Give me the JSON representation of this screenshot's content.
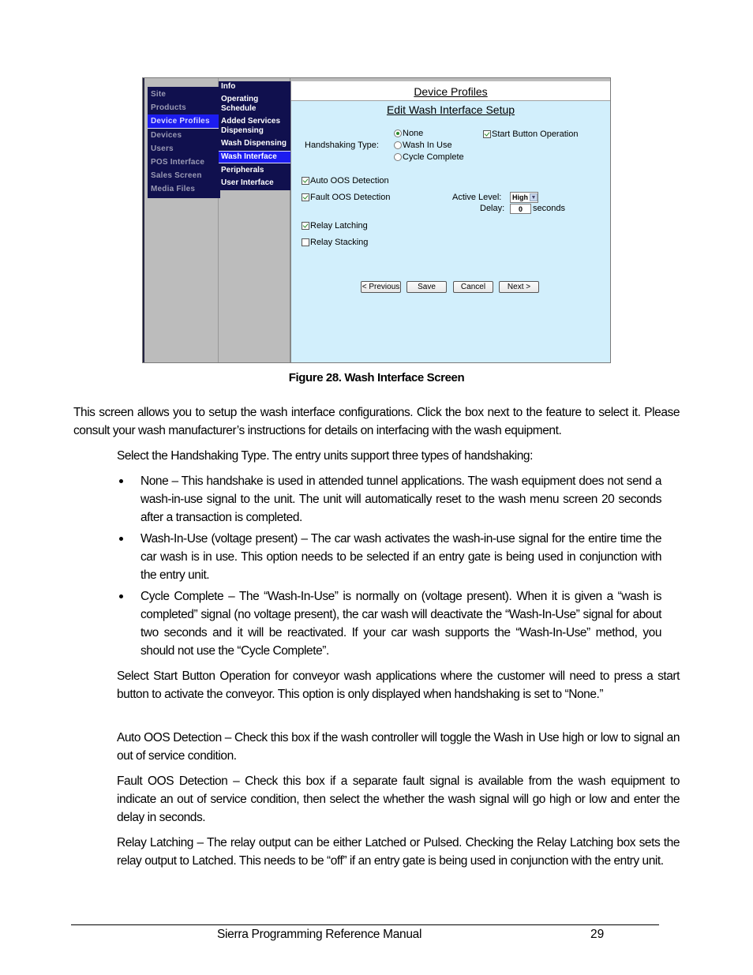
{
  "screenshot": {
    "left_menu": [
      {
        "label": "Site",
        "active": false
      },
      {
        "label": "Products",
        "active": false
      },
      {
        "label": "Device Profiles",
        "active": true
      },
      {
        "label": "Devices",
        "active": false
      },
      {
        "label": "Users",
        "active": false
      },
      {
        "label": "POS Interface",
        "active": false
      },
      {
        "label": "Sales Screen",
        "active": false
      },
      {
        "label": "Media Files",
        "active": false
      }
    ],
    "sub_menu": [
      {
        "label": "Info",
        "active": false
      },
      {
        "label": "Operating Schedule",
        "active": false
      },
      {
        "label": "Added Services Dispensing",
        "active": false
      },
      {
        "label": "Wash Dispensing",
        "active": false
      },
      {
        "label": "Wash Interface",
        "active": true
      },
      {
        "label": "Peripherals",
        "active": false
      },
      {
        "label": "User Interface",
        "active": false
      }
    ],
    "page_title": "Device Profiles",
    "form_title": "Edit Wash Interface Setup",
    "handshaking": {
      "label": "Handshaking Type:",
      "options": [
        {
          "label": "None",
          "selected": true
        },
        {
          "label": "Wash In Use",
          "selected": false
        },
        {
          "label": "Cycle Complete",
          "selected": false
        }
      ]
    },
    "start_button_operation": {
      "label": "Start Button Operation",
      "checked": true
    },
    "auto_oos": {
      "label": "Auto OOS Detection",
      "checked": true
    },
    "fault_oos": {
      "label": "Fault OOS Detection",
      "checked": true
    },
    "active_level": {
      "label": "Active Level:",
      "value": "High"
    },
    "delay": {
      "label": "Delay:",
      "value": "0",
      "unit": "seconds"
    },
    "relay_latching": {
      "label": "Relay Latching",
      "checked": true
    },
    "relay_stacking": {
      "label": "Relay Stacking",
      "checked": false
    },
    "buttons": {
      "previous": "< Previous",
      "save": "Save",
      "cancel": "Cancel",
      "next": "Next >"
    }
  },
  "caption": "Figure 28. Wash Interface Screen",
  "intro": "This screen allows you to setup the wash interface configurations. Click the box next to the feature to select it. Please consult your wash manufacturer’s instructions for details on interfacing with the wash equipment.",
  "handshake_intro": "Select the Handshaking Type. The entry units support three types of handshaking:",
  "bullets": [
    "None – This handshake is used in attended tunnel applications. The wash equipment does not send a wash-in-use signal to the unit. The unit will automatically reset to the wash menu screen 20 seconds after a transaction is completed.",
    "Wash-In-Use (voltage present) – The car wash activates the wash-in-use signal for the entire time the car wash is in use. This option needs to be selected if an entry gate is being used in conjunction with the entry unit.",
    "Cycle Complete – The “Wash-In-Use” is normally on (voltage present). When it is given a “wash is completed” signal (no voltage present), the car wash will deactivate the “Wash-In-Use” signal for about two seconds and it will be reactivated. If your car wash supports the “Wash-In-Use” method, you should not use the “Cycle Complete”."
  ],
  "paragraphs": [
    "Select Start Button Operation for conveyor wash applications where the customer will need to press a start button to activate the conveyor. This option is only displayed when handshaking is set to “None.”",
    "Auto OOS Detection – Check this box if the wash controller will toggle the Wash in Use high or low to signal an out of service condition.",
    "Fault OOS Detection – Check this box if a separate fault signal is available from the wash equipment to indicate an out of service condition, then select the whether the wash signal will go high or low and enter the delay in seconds.",
    "Relay Latching – The relay output can be either Latched or Pulsed. Checking the Relay Latching box sets the relay output to Latched. This needs to be “off” if an entry gate is being used in conjunction with the entry unit."
  ],
  "footer": {
    "title": "Sierra Programming Reference Manual",
    "page": "29"
  }
}
